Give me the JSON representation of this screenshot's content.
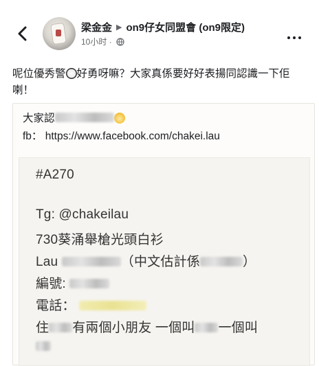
{
  "header": {
    "author": "梁金金",
    "group": "on9仔女同盟會 (on9限定)",
    "time": "10小时",
    "separator": "·"
  },
  "post": {
    "text_before": "呢位優秀警",
    "text_after": "好勇呀嘛？大家真係要好好表揚同認識一下佢喇！"
  },
  "card": {
    "caption_prefix": "大家認",
    "fb_label": "fb：",
    "fb_url": "https://www.facebook.com/chakei.lau"
  },
  "doc": {
    "tag": "#A270",
    "tg": "Tg: @chakeilau",
    "line3": "730葵涌舉槍光頭白衫",
    "line4_a": "Lau",
    "line4_b": "（中文估計係",
    "line4_c": "）",
    "line5": "編號:",
    "line6": "電話：",
    "line7_a": "住",
    "line7_b": "有兩個小朋友 一個叫",
    "line7_c": "一個叫"
  },
  "colors": {
    "text": "#1c1e21",
    "meta": "#65676b",
    "doc_text": "#333333"
  }
}
